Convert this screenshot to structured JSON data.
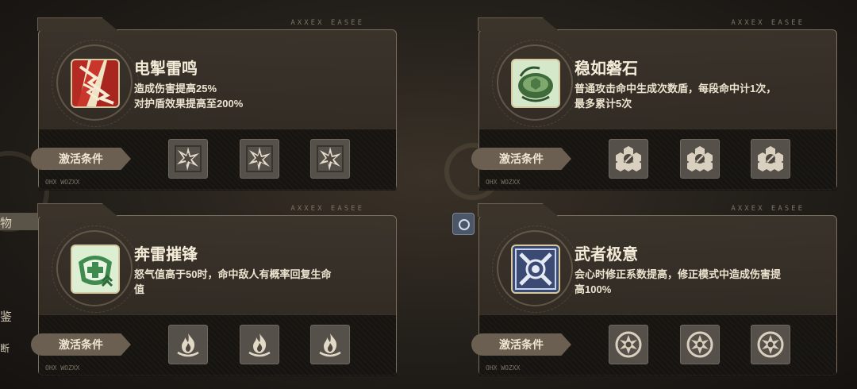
{
  "sidebar": {
    "wu_label": "物",
    "jian_label": "鉴",
    "duan_label": "断"
  },
  "cards": [
    {
      "title": "电掣雷鸣",
      "desc_lines": [
        "造成伤害提高25%",
        "对护盾效果提高至200%"
      ],
      "condition_label": "激活条件",
      "icon": "lightning-icon",
      "slot_icon": "lightning-burst-icon",
      "deco": "AXXEX EASEE",
      "foot": "OHX WOZXX"
    },
    {
      "title": "稳如磐石",
      "desc_lines": [
        "普通攻击命中生成次数盾，每段命中计1次，",
        "最多累计5次"
      ],
      "condition_label": "激活条件",
      "icon": "turtle-shell-icon",
      "slot_icon": "hexagon-cluster-icon",
      "deco": "AXXEX EASEE",
      "foot": "OHX WOZXX"
    },
    {
      "title": "奔雷摧锋",
      "desc_lines": [
        "怒气值高于50时，命中敌人有概率回复生命",
        "值"
      ],
      "condition_label": "激活条件",
      "icon": "heal-cross-icon",
      "slot_icon": "flame-icon",
      "deco": "AXXEX EASEE",
      "foot": "OHX WOZXX"
    },
    {
      "title": "武者极意",
      "desc_lines": [
        "会心时修正系数提高，修正模式中造成伤害提",
        "高100%"
      ],
      "condition_label": "激活条件",
      "icon": "crossed-swords-icon",
      "slot_icon": "spiral-star-icon",
      "deco": "AXXEX EASEE",
      "foot": "OHX WOZXX"
    }
  ]
}
